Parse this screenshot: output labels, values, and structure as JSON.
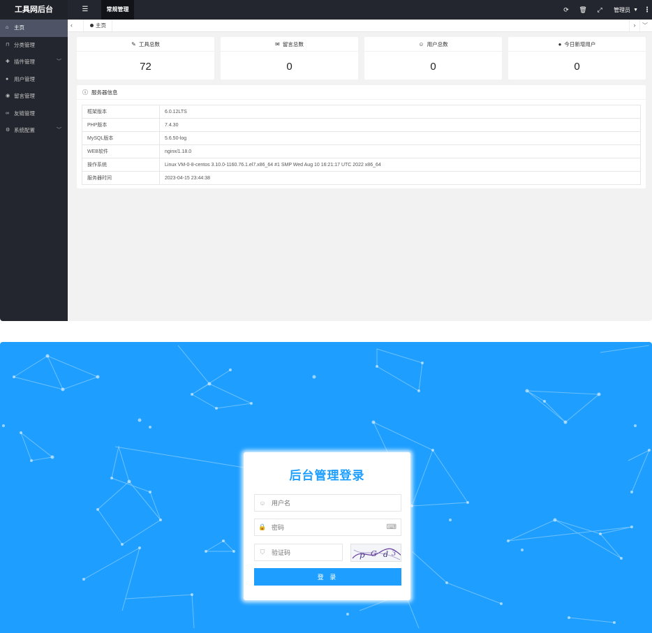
{
  "admin": {
    "logo": "工具网后台",
    "top_tab": "常规管理",
    "user_name": "管理员",
    "sidebar": [
      {
        "label": "主页",
        "icon": "home-icon",
        "active": true
      },
      {
        "label": "分类管理",
        "icon": "bookmark-icon"
      },
      {
        "label": "插件管理",
        "icon": "puzzle-icon",
        "has_children": true
      },
      {
        "label": "用户管理",
        "icon": "user-icon"
      },
      {
        "label": "留言管理",
        "icon": "comments-icon"
      },
      {
        "label": "友链管理",
        "icon": "link-icon"
      },
      {
        "label": "系统配置",
        "icon": "gears-icon",
        "has_children": true
      }
    ],
    "tab_home": "主页",
    "stats": [
      {
        "label": "工具总数",
        "value": "72",
        "icon": "edit-icon"
      },
      {
        "label": "留言总数",
        "value": "0",
        "icon": "message-icon"
      },
      {
        "label": "用户总数",
        "value": "0",
        "icon": "user-outline-icon"
      },
      {
        "label": "今日新增用户",
        "value": "0",
        "icon": "user-solid-icon"
      }
    ],
    "server": {
      "title": "服务器信息",
      "rows": [
        {
          "key": "框架版本",
          "value": "6.0.12LTS"
        },
        {
          "key": "PHP版本",
          "value": "7.4.30"
        },
        {
          "key": "MySQL版本",
          "value": "5.6.50-log"
        },
        {
          "key": "WEB软件",
          "value": "nginx/1.18.0"
        },
        {
          "key": "操作系统",
          "value": "Linux VM-0-8-centos 3.10.0-1160.76.1.el7.x86_64 #1 SMP Wed Aug 10 16:21:17 UTC 2022 x86_64"
        },
        {
          "key": "服务器时间",
          "value": "2023-04-15 23:44:38"
        }
      ]
    }
  },
  "login": {
    "title": "后台管理登录",
    "username_placeholder": "用户名",
    "password_placeholder": "密码",
    "captcha_placeholder": "验证码",
    "submit_label": "登 录"
  },
  "colors": {
    "sidebar_bg": "#23262e",
    "login_bg": "#1e9fff",
    "accent": "#1e9fff"
  }
}
